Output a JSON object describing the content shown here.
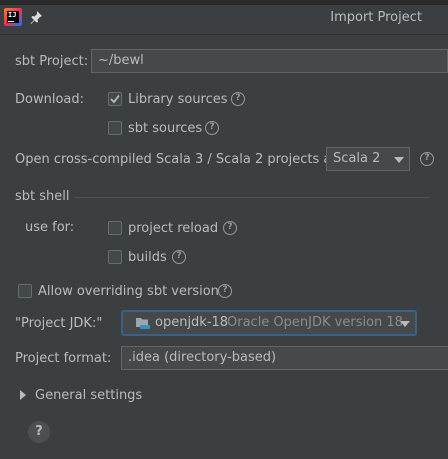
{
  "window": {
    "title": "Import Project"
  },
  "sbt_project": {
    "label": "sbt Project:",
    "value": "~/bewl"
  },
  "download": {
    "label": "Download:",
    "library_sources": {
      "label": "Library sources",
      "checked": true
    },
    "sbt_sources": {
      "label": "sbt sources",
      "checked": false
    }
  },
  "cross_compiled": {
    "label": "Open cross-compiled Scala 3 / Scala 2 projects as:",
    "value": "Scala 2"
  },
  "sbt_shell": {
    "section_label": "sbt shell",
    "use_for_label": "use for:",
    "project_reload": {
      "label": "project reload",
      "checked": false
    },
    "builds": {
      "label": "builds",
      "checked": false
    }
  },
  "allow_overriding": {
    "label": "Allow overriding sbt version",
    "checked": false
  },
  "project_jdk": {
    "label": "\"Project JDK:\"",
    "name": "openjdk-18",
    "detail": "Oracle OpenJDK version 18"
  },
  "project_format": {
    "label": "Project format:",
    "value": ".idea (directory-based)"
  },
  "general_settings": {
    "label": "General settings",
    "expanded": false
  },
  "help": {
    "glyph": "?"
  },
  "colors": {
    "background": "#3c3f41",
    "text": "#bbbbbb",
    "focus_border": "#3d6185",
    "folder_icon": "#3592c4"
  },
  "icons": [
    "intellij-app-icon",
    "pin-icon",
    "checkmark-icon",
    "help-icon",
    "chevron-down-icon",
    "folder-icon",
    "triangle-right-icon"
  ]
}
